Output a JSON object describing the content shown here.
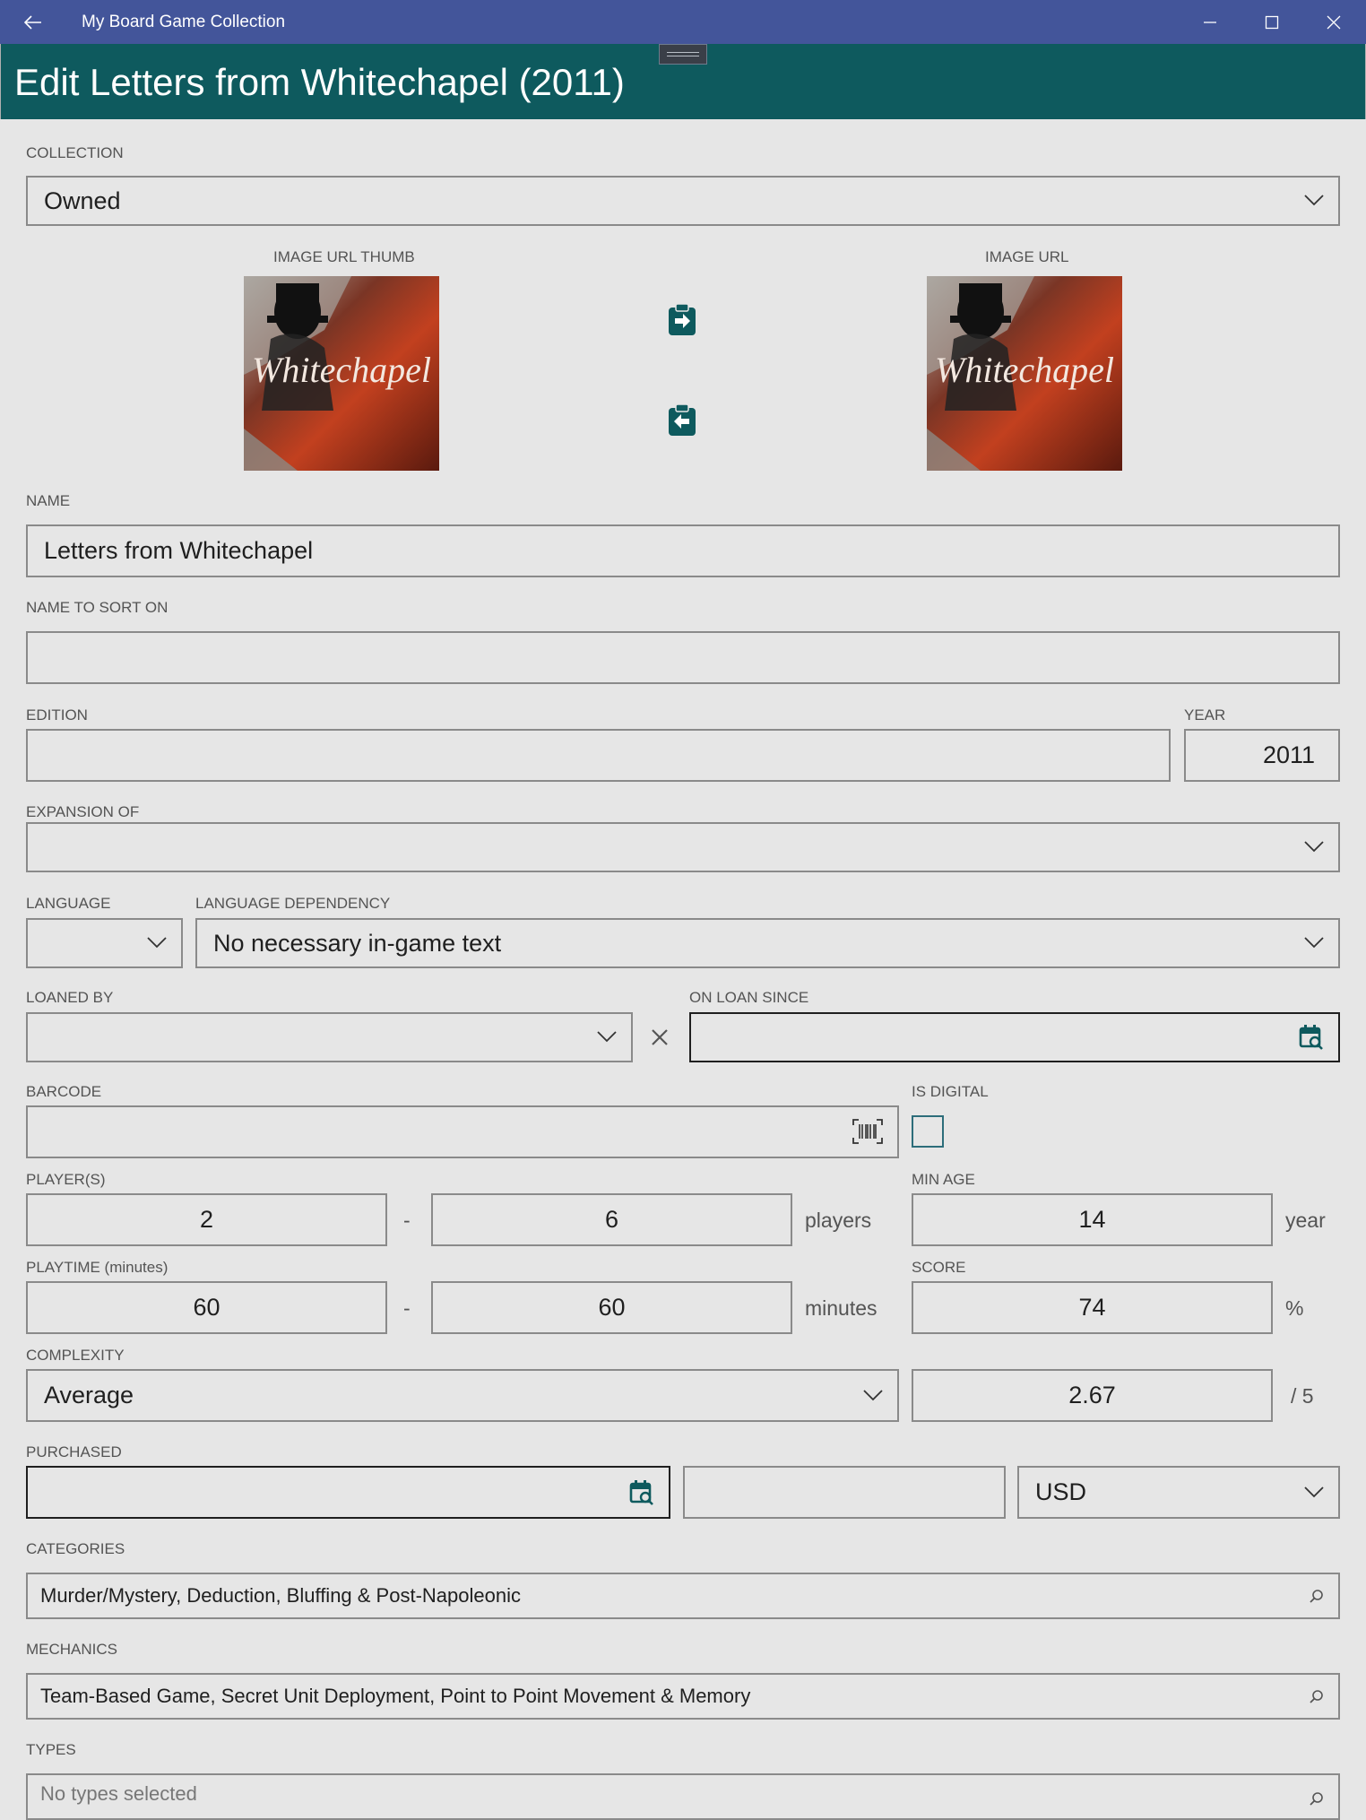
{
  "window": {
    "title": "My Board Game Collection",
    "back_icon": "arrow-left-icon",
    "controls": [
      "minimize-icon",
      "maximize-icon",
      "close-icon"
    ]
  },
  "header": {
    "title": "Edit Letters from Whitechapel (2011)",
    "color": "#0e5a5e"
  },
  "titlebar_color": "#43559a",
  "accent_icon_color": "#0e5a5e",
  "collection": {
    "label": "COLLECTION",
    "value": "Owned"
  },
  "images": {
    "thumb_label": "IMAGE URL THUMB",
    "url_label": "IMAGE URL",
    "cover_text": "Whitechapel",
    "copy_right_icon": "clipboard-arrow-right-icon",
    "copy_left_icon": "clipboard-arrow-left-icon"
  },
  "name": {
    "label": "NAME",
    "value": "Letters from Whitechapel"
  },
  "sort_name": {
    "label": "NAME TO SORT ON",
    "value": ""
  },
  "edition": {
    "label": "EDITION",
    "value": ""
  },
  "year": {
    "label": "YEAR",
    "value": "2011"
  },
  "expansion_of": {
    "label": "EXPANSION OF",
    "value": ""
  },
  "language": {
    "label": "LANGUAGE",
    "value": ""
  },
  "language_dependency": {
    "label": "LANGUAGE DEPENDENCY",
    "value": "No necessary in-game text"
  },
  "loaned_by": {
    "label": "LOANED BY",
    "value": ""
  },
  "on_loan_since": {
    "label": "ON LOAN SINCE",
    "value": ""
  },
  "barcode": {
    "label": "BARCODE",
    "value": ""
  },
  "is_digital": {
    "label": "IS DIGITAL",
    "checked": false
  },
  "players": {
    "label": "PLAYER(S)",
    "min": "2",
    "max": "6",
    "unit": "players",
    "separator": "-"
  },
  "min_age": {
    "label": "MIN AGE",
    "value": "14",
    "unit": "year"
  },
  "playtime": {
    "label": "PLAYTIME (minutes)",
    "min": "60",
    "max": "60",
    "unit": "minutes",
    "separator": "-"
  },
  "score": {
    "label": "SCORE",
    "value": "74",
    "unit": "%"
  },
  "complexity": {
    "label": "COMPLEXITY",
    "value": "Average",
    "rating": "2.67",
    "unit": "/ 5"
  },
  "purchased": {
    "label": "PURCHASED",
    "date": "",
    "price": "",
    "currency": "USD"
  },
  "categories": {
    "label": "CATEGORIES",
    "value": "Murder/Mystery, Deduction, Bluffing & Post-Napoleonic"
  },
  "mechanics": {
    "label": "MECHANICS",
    "value": "Team-Based Game, Secret Unit Deployment, Point to Point Movement & Memory"
  },
  "types": {
    "label": "TYPES",
    "placeholder": "No types selected"
  }
}
